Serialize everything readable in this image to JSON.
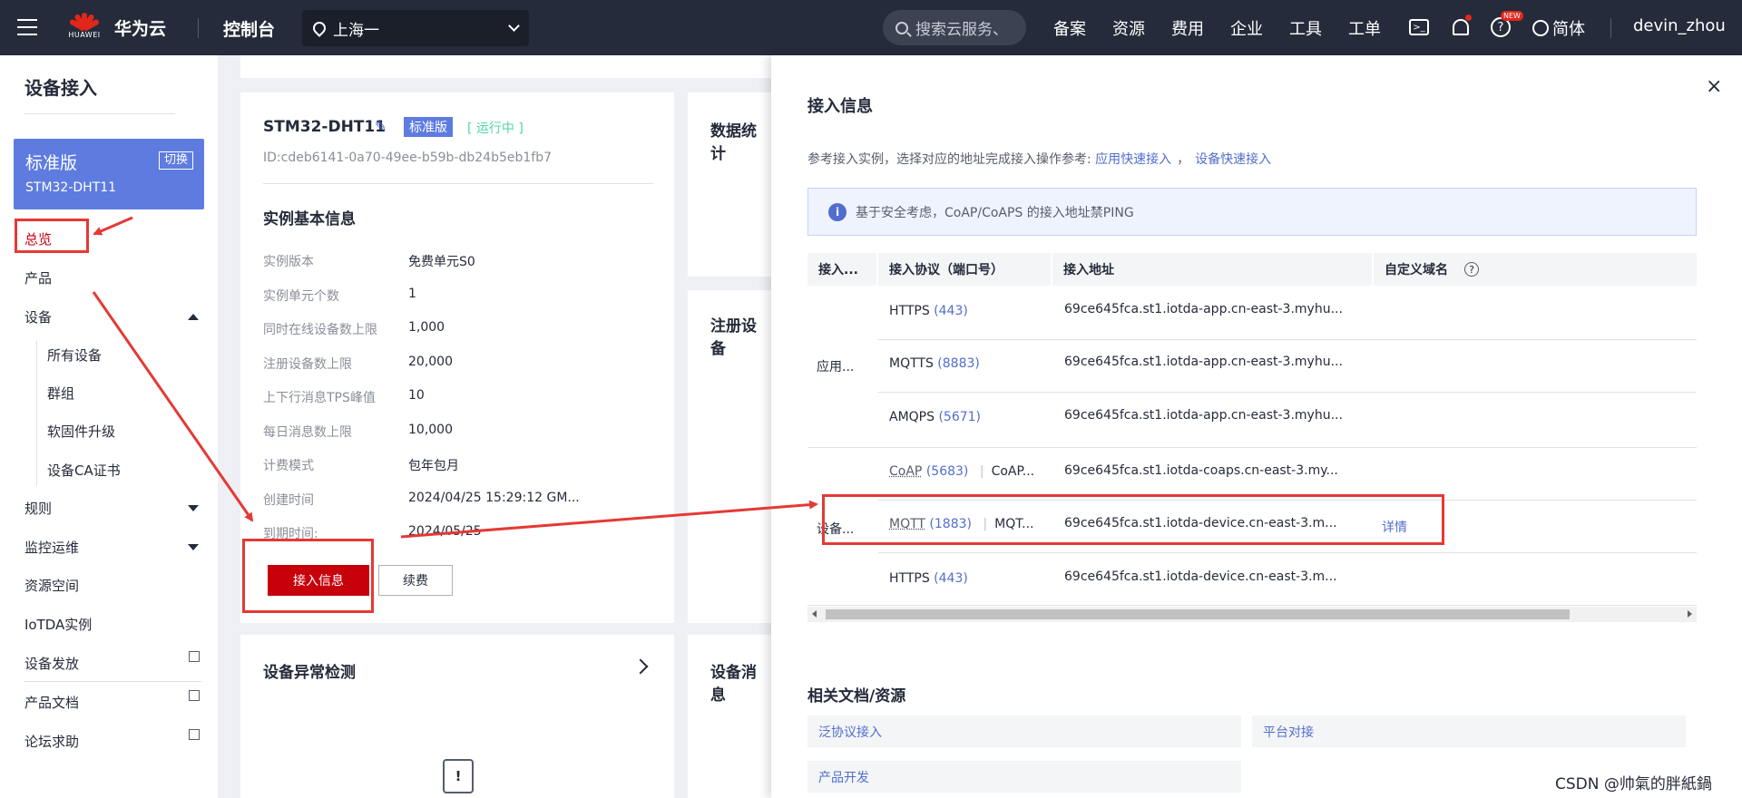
{
  "topbar": {
    "logo_text": "HUAWEI",
    "brand": "华为云",
    "console": "控制台",
    "region": "上海一",
    "search_placeholder": "搜索云服务、",
    "nav": [
      "备案",
      "资源",
      "费用",
      "企业",
      "工具",
      "工单"
    ],
    "new_badge": "NEW",
    "language": "简体",
    "user": "devin_zhou"
  },
  "sidebar": {
    "title": "设备接入",
    "edition": "标准版",
    "switch_label": "切换",
    "instance": "STM32-DHT11",
    "items": {
      "overview": "总览",
      "product": "产品",
      "device": "设备",
      "all_devices": "所有设备",
      "group": "群组",
      "firmware": "软固件升级",
      "ca": "设备CA证书",
      "rules": "规则",
      "monitor": "监控运维",
      "resource_space": "资源空间",
      "iotda": "IoTDA实例",
      "provision": "设备发放",
      "product_docs": "产品文档",
      "forum": "论坛求助"
    }
  },
  "instance_card": {
    "name": "STM32-DHT11",
    "tag_edition": "标准版",
    "tag_status": "[ 运行中 ]",
    "id": "ID:cdeb6141-0a70-49ee-b59b-db24b5eb1fb7",
    "section": "实例基本信息",
    "rows": [
      {
        "k": "实例版本",
        "v": "免费单元S0"
      },
      {
        "k": "实例单元个数",
        "v": "1"
      },
      {
        "k": "同时在线设备数上限",
        "v": "1,000"
      },
      {
        "k": "注册设备数上限",
        "v": "20,000"
      },
      {
        "k": "上下行消息TPS峰值",
        "v": "10"
      },
      {
        "k": "每日消息数上限",
        "v": "10,000"
      },
      {
        "k": "计费模式",
        "v": "包年包月"
      },
      {
        "k": "创建时间",
        "v": "2024/04/25 15:29:12 GM..."
      },
      {
        "k": "到期时间:",
        "v": "2024/05/25"
      }
    ],
    "btn_access": "接入信息",
    "btn_renew": "续费"
  },
  "cards": {
    "data_stats": "数据统计",
    "registered": "注册设备",
    "anomaly": "设备异常检测",
    "messages": "设备消息"
  },
  "drawer": {
    "title": "接入信息",
    "close": "×",
    "ref_text": "参考接入实例，选择对应的地址完成接入操作参考: ",
    "ref_link1": "应用快速接入",
    "ref_sep": "，",
    "ref_link2": "设备快速接入",
    "notice": "基于安全考虑，CoAP/CoAPS 的接入地址禁PING",
    "columns": [
      "接入...",
      "接入协议（端口号）",
      "接入地址",
      "自定义域名"
    ],
    "group_app": "应用...",
    "group_device": "设备...",
    "rows": [
      {
        "proto": "HTTPS",
        "port": "(443)",
        "addr": "69ce645fca.st1.iotda-app.cn-east-3.myhu..."
      },
      {
        "proto": "MQTTS",
        "port": "(8883)",
        "addr": "69ce645fca.st1.iotda-app.cn-east-3.myhu..."
      },
      {
        "proto": "AMQPS",
        "port": "(5671)",
        "addr": "69ce645fca.st1.iotda-app.cn-east-3.myhu..."
      },
      {
        "proto": "CoAP",
        "port": "(5683)",
        "proto2": "CoAP...",
        "addr": "69ce645fca.st1.iotda-coaps.cn-east-3.my..."
      },
      {
        "proto": "MQTT",
        "port": "(1883)",
        "proto2": "MQT...",
        "addr": "69ce645fca.st1.iotda-device.cn-east-3.m...",
        "detail": "详情"
      },
      {
        "proto": "HTTPS",
        "port": "(443)",
        "addr": "69ce645fca.st1.iotda-device.cn-east-3.m..."
      }
    ],
    "docs_title": "相关文档/资源",
    "docs": [
      "泛协议接入",
      "平台对接",
      "产品开发"
    ]
  },
  "watermark": "CSDN @帅氣的胖紙鍋",
  "colors": {
    "brand_red": "#c7000b",
    "annotation_red": "#e53935",
    "link": "#526ecc",
    "edition_blue": "#5e7ce0"
  }
}
